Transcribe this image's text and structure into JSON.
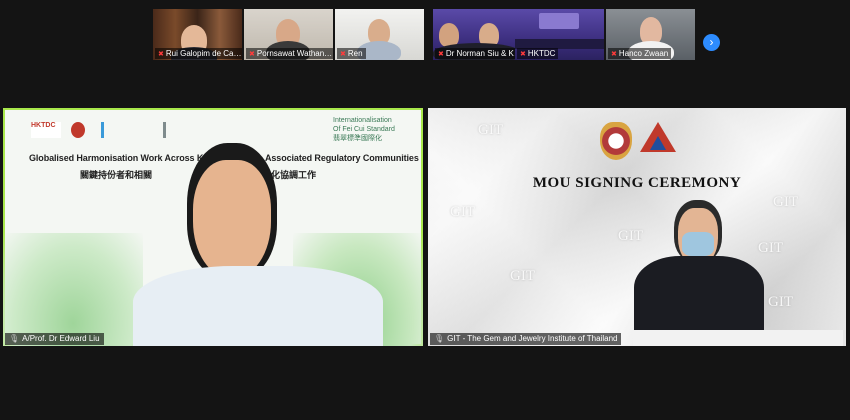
{
  "participants": [
    {
      "name": "Rui Galopim de Carval...",
      "muted": true
    },
    {
      "name": "Pornsawat Wathanakul",
      "muted": true
    },
    {
      "name": "Ren",
      "muted": true
    },
    {
      "name": "Dr Norman Siu & Kent...",
      "muted": true
    },
    {
      "name": "HKTDC",
      "muted": true
    },
    {
      "name": "Hanco Zwaan",
      "muted": true
    }
  ],
  "next_page_icon": "chevron-right-icon",
  "active_speaker": {
    "label": "A/Prof. Dr Edward Liu",
    "border_color": "#a9e84c",
    "banner": {
      "title_left": "Globalised Harmonisation Work Across K",
      "title_right": "Associated Regulatory Communities",
      "subtitle_left": "關鍵持份者和相關",
      "subtitle_right": "化協調工作",
      "logo_left": "HKTDC",
      "logo_right_line1": "Internationalisation",
      "logo_right_line2": "Of Fei Cui Standard",
      "logo_right_line3": "翡翠標準國際化"
    }
  },
  "presenter": {
    "label": "GIT - The Gem and Jewelry Institute of Thailand",
    "title": "MOU SIGNING CEREMONY",
    "watermark": "GIT"
  },
  "colors": {
    "accent": "#2d8cff",
    "muted_mic": "#ff3b3b",
    "speaker_border": "#a9e84c"
  }
}
